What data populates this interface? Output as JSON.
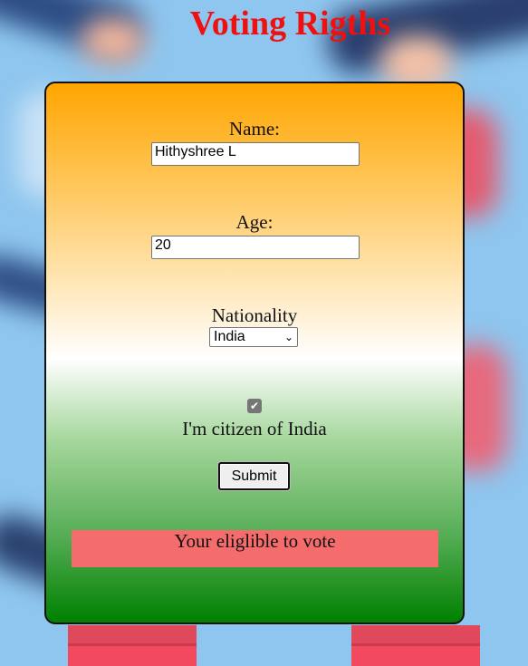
{
  "page": {
    "title": "Voting Rigths"
  },
  "form": {
    "name_label": "Name:",
    "name_value": "Hithyshree L",
    "age_label": "Age:",
    "age_value": "20",
    "nationality_label": "Nationality",
    "nationality_selected": "India",
    "citizen_checked": true,
    "citizen_label": "I'm citizen of India",
    "submit_label": "Submit"
  },
  "result": {
    "message": "Your eliglible to vote"
  },
  "colors": {
    "title": "#f01010",
    "saffron": "#ffa500",
    "green": "#008000",
    "result_bg": "#f56c6c"
  }
}
